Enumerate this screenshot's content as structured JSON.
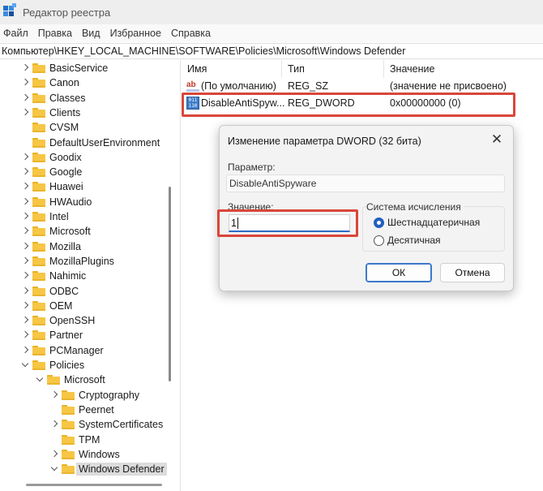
{
  "window": {
    "title": "Редактор реестра"
  },
  "menu": [
    "Файл",
    "Правка",
    "Вид",
    "Избранное",
    "Справка"
  ],
  "address": "Компьютер\\HKEY_LOCAL_MACHINE\\SOFTWARE\\Policies\\Microsoft\\Windows Defender",
  "tree": [
    {
      "label": "BasicService",
      "expand": "collapsed",
      "level": 0
    },
    {
      "label": "Canon",
      "expand": "collapsed",
      "level": 0
    },
    {
      "label": "Classes",
      "expand": "collapsed",
      "level": 0
    },
    {
      "label": "Clients",
      "expand": "collapsed",
      "level": 0
    },
    {
      "label": "CVSM",
      "expand": "none",
      "level": 0
    },
    {
      "label": "DefaultUserEnvironment",
      "expand": "none",
      "level": 0
    },
    {
      "label": "Goodix",
      "expand": "collapsed",
      "level": 0
    },
    {
      "label": "Google",
      "expand": "collapsed",
      "level": 0
    },
    {
      "label": "Huawei",
      "expand": "collapsed",
      "level": 0
    },
    {
      "label": "HWAudio",
      "expand": "collapsed",
      "level": 0
    },
    {
      "label": "Intel",
      "expand": "collapsed",
      "level": 0
    },
    {
      "label": "Microsoft",
      "expand": "collapsed",
      "level": 0
    },
    {
      "label": "Mozilla",
      "expand": "collapsed",
      "level": 0
    },
    {
      "label": "MozillaPlugins",
      "expand": "collapsed",
      "level": 0
    },
    {
      "label": "Nahimic",
      "expand": "collapsed",
      "level": 0
    },
    {
      "label": "ODBC",
      "expand": "collapsed",
      "level": 0
    },
    {
      "label": "OEM",
      "expand": "collapsed",
      "level": 0
    },
    {
      "label": "OpenSSH",
      "expand": "collapsed",
      "level": 0
    },
    {
      "label": "Partner",
      "expand": "collapsed",
      "level": 0
    },
    {
      "label": "PCManager",
      "expand": "collapsed",
      "level": 0
    },
    {
      "label": "Policies",
      "expand": "expanded",
      "level": 0
    },
    {
      "label": "Microsoft",
      "expand": "expanded",
      "level": 1
    },
    {
      "label": "Cryptography",
      "expand": "collapsed",
      "level": 2
    },
    {
      "label": "Peernet",
      "expand": "none",
      "level": 2
    },
    {
      "label": "SystemCertificates",
      "expand": "collapsed",
      "level": 2
    },
    {
      "label": "TPM",
      "expand": "none",
      "level": 2
    },
    {
      "label": "Windows",
      "expand": "collapsed",
      "level": 2
    },
    {
      "label": "Windows Defender",
      "expand": "expanded",
      "level": 2,
      "selected": true
    }
  ],
  "columns": {
    "name": "Имя",
    "type": "Тип",
    "value": "Значение"
  },
  "values": [
    {
      "icon": "string-value-icon",
      "icon_text": "ab",
      "name": "(По умолчанию)",
      "type": "REG_SZ",
      "data": "(значение не присвоено)"
    },
    {
      "icon": "binary-value-icon",
      "icon_text": "011 110",
      "name": "DisableAntiSpyw...",
      "type": "REG_DWORD",
      "data": "0x00000000 (0)"
    }
  ],
  "dialog": {
    "title": "Изменение параметра DWORD (32 бита)",
    "close_glyph": "✕",
    "param_label": "Параметр:",
    "param_value": "DisableAntiSpyware",
    "value_label": "Значение:",
    "value_input": "1",
    "base_label": "Система исчисления",
    "base_options": [
      {
        "label": "Шестнадцатеричная",
        "checked": true
      },
      {
        "label": "Десятичная",
        "checked": false
      }
    ],
    "ok_label": "ОК",
    "cancel_label": "Отмена"
  },
  "colors": {
    "highlight": "#d9463a",
    "accent": "#1f5fbf",
    "folder": "#f6c644"
  }
}
